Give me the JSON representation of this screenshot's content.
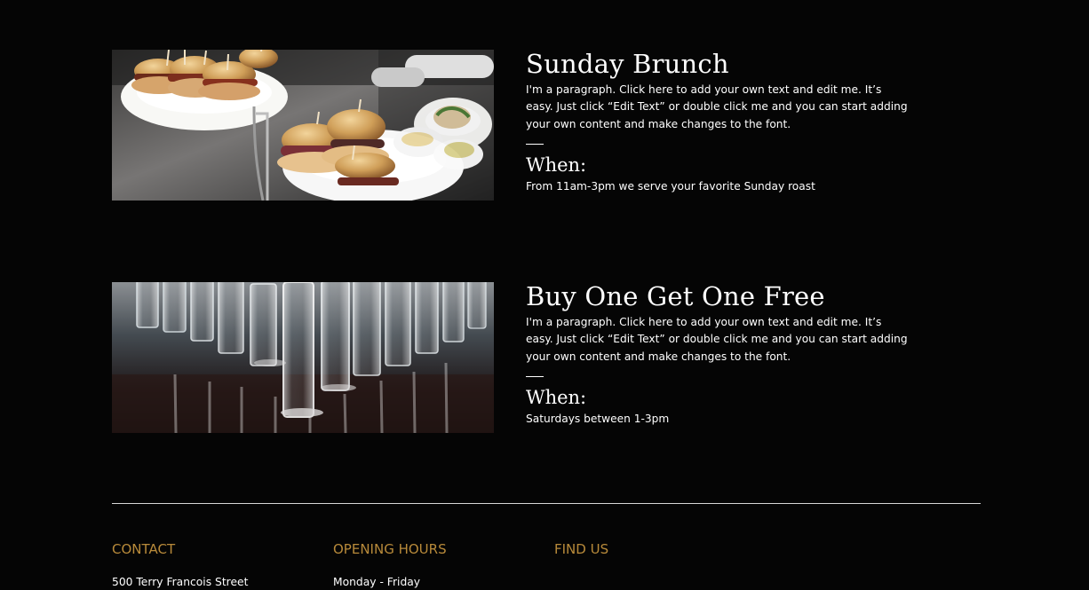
{
  "promotions": [
    {
      "title": "Sunday Brunch",
      "description": "I'm a paragraph. Click here to add your own text and edit me. It’s easy. Just click “Edit Text” or double click me and you can start adding your own content and make changes to the font.",
      "when_label": "When:",
      "when_text": "From 11am-3pm we serve your favorite Sunday roast"
    },
    {
      "title": "Buy One Get One Free",
      "description": "I'm a paragraph. Click here to add your own text and edit me. It’s easy. Just click “Edit Text” or double click me and you can start adding your own content and make changes to the font.",
      "when_label": "When:",
      "when_text": "Saturdays between 1-3pm"
    }
  ],
  "footer": {
    "contact": {
      "heading": "CONTACT",
      "text": "500 Terry Francois Street"
    },
    "hours": {
      "heading": "OPENING HOURS",
      "text": "Monday - Friday"
    },
    "find": {
      "heading": "FIND US"
    }
  },
  "colors": {
    "background": "#050505",
    "text": "#ffffff",
    "footer_heading": "#b88a3a",
    "divider": "#d8d8d8"
  }
}
